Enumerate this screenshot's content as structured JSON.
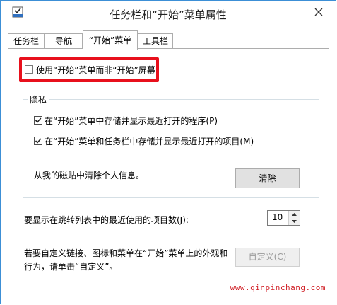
{
  "window": {
    "title": "任务栏和“开始”菜单属性"
  },
  "tabs": [
    {
      "label": "任务栏"
    },
    {
      "label": "导航"
    },
    {
      "label": "“开始”菜单"
    },
    {
      "label": "工具栏"
    }
  ],
  "start_tab": {
    "use_start_screen": {
      "label": "使用“开始”菜单而非“开始”屏幕",
      "checked": false
    },
    "privacy": {
      "title": "隐私",
      "store_programs": {
        "label": "在“开始”菜单中存储并显示最近打开的程序(P)",
        "checked": true
      },
      "store_items": {
        "label": "在“开始”菜单和任务栏中存储并显示最近打开的项目(M)",
        "checked": true
      },
      "clear_text": "从我的磁贴中清除个人信息。",
      "clear_button": "清除"
    },
    "jump_list": {
      "label": "要显示在跳转列表中的最近使用的项目数(J):",
      "value": "10"
    },
    "customize": {
      "text_line1": "若要自定义链接、图标和菜单在“开始”菜单上的外观和",
      "text_line2": "行为，请单击“自定义”。",
      "button": "自定义(C)"
    }
  },
  "watermark": "www.qinpinchang.com",
  "colors": {
    "highlight": "#e8101c",
    "window_border": "#3c8fd6",
    "watermark": "#d12027"
  }
}
